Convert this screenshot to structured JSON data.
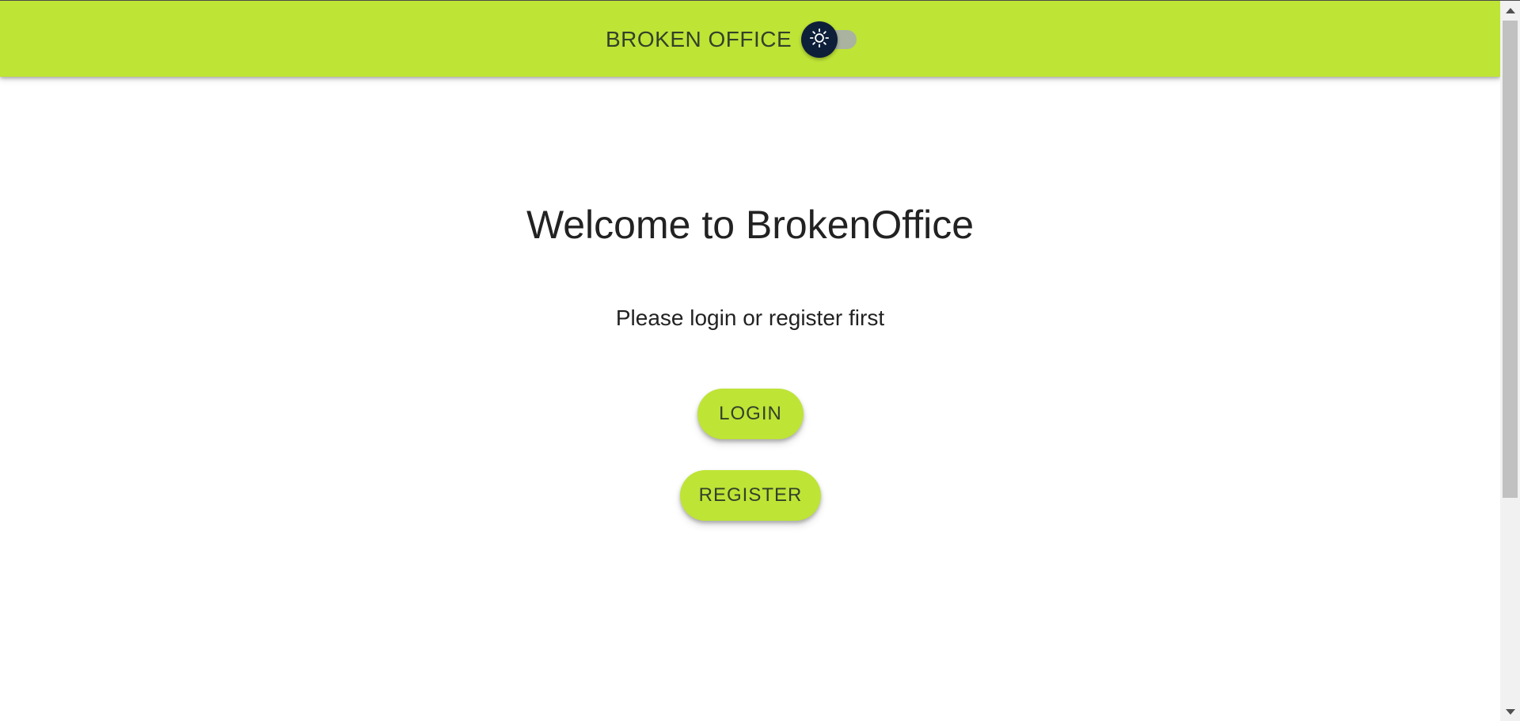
{
  "appbar": {
    "brand": "BROKEN OFFICE",
    "background_color": "#bee436",
    "theme_toggle": {
      "icon": "sun-icon",
      "state": "light",
      "checked": false
    }
  },
  "main": {
    "title": "Welcome to BrokenOffice",
    "subtitle": "Please login or register first",
    "login_label": "LOGIN",
    "register_label": "REGISTER",
    "button_color": "#bee436"
  },
  "scrollbar": {
    "up_icon": "scroll-up-arrow-icon",
    "down_icon": "scroll-down-arrow-icon"
  }
}
